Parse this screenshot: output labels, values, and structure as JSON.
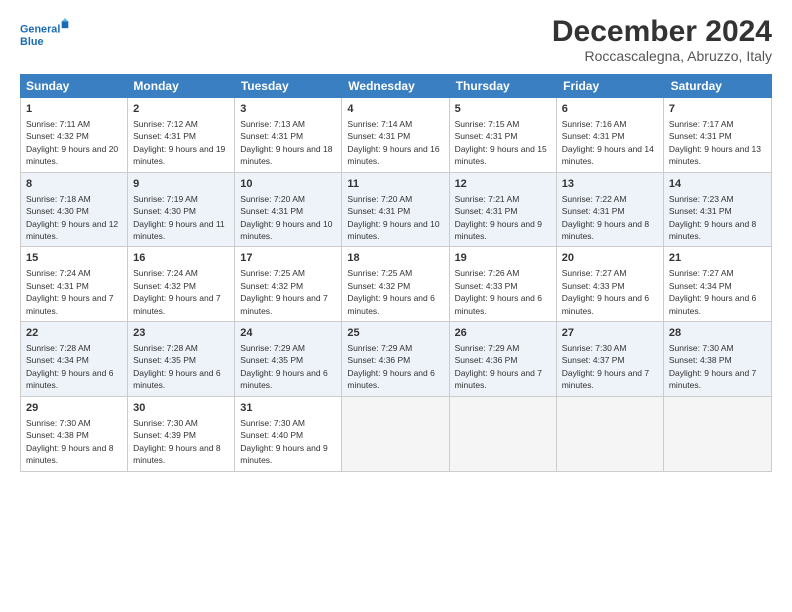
{
  "logo": {
    "line1": "General",
    "line2": "Blue"
  },
  "title": "December 2024",
  "location": "Roccascalegna, Abruzzo, Italy",
  "header_days": [
    "Sunday",
    "Monday",
    "Tuesday",
    "Wednesday",
    "Thursday",
    "Friday",
    "Saturday"
  ],
  "weeks": [
    [
      {
        "day": 1,
        "sunrise": "7:11 AM",
        "sunset": "4:32 PM",
        "daylight": "9 hours and 20 minutes."
      },
      {
        "day": 2,
        "sunrise": "7:12 AM",
        "sunset": "4:31 PM",
        "daylight": "9 hours and 19 minutes."
      },
      {
        "day": 3,
        "sunrise": "7:13 AM",
        "sunset": "4:31 PM",
        "daylight": "9 hours and 18 minutes."
      },
      {
        "day": 4,
        "sunrise": "7:14 AM",
        "sunset": "4:31 PM",
        "daylight": "9 hours and 16 minutes."
      },
      {
        "day": 5,
        "sunrise": "7:15 AM",
        "sunset": "4:31 PM",
        "daylight": "9 hours and 15 minutes."
      },
      {
        "day": 6,
        "sunrise": "7:16 AM",
        "sunset": "4:31 PM",
        "daylight": "9 hours and 14 minutes."
      },
      {
        "day": 7,
        "sunrise": "7:17 AM",
        "sunset": "4:31 PM",
        "daylight": "9 hours and 13 minutes."
      }
    ],
    [
      {
        "day": 8,
        "sunrise": "7:18 AM",
        "sunset": "4:30 PM",
        "daylight": "9 hours and 12 minutes."
      },
      {
        "day": 9,
        "sunrise": "7:19 AM",
        "sunset": "4:30 PM",
        "daylight": "9 hours and 11 minutes."
      },
      {
        "day": 10,
        "sunrise": "7:20 AM",
        "sunset": "4:31 PM",
        "daylight": "9 hours and 10 minutes."
      },
      {
        "day": 11,
        "sunrise": "7:20 AM",
        "sunset": "4:31 PM",
        "daylight": "9 hours and 10 minutes."
      },
      {
        "day": 12,
        "sunrise": "7:21 AM",
        "sunset": "4:31 PM",
        "daylight": "9 hours and 9 minutes."
      },
      {
        "day": 13,
        "sunrise": "7:22 AM",
        "sunset": "4:31 PM",
        "daylight": "9 hours and 8 minutes."
      },
      {
        "day": 14,
        "sunrise": "7:23 AM",
        "sunset": "4:31 PM",
        "daylight": "9 hours and 8 minutes."
      }
    ],
    [
      {
        "day": 15,
        "sunrise": "7:24 AM",
        "sunset": "4:31 PM",
        "daylight": "9 hours and 7 minutes."
      },
      {
        "day": 16,
        "sunrise": "7:24 AM",
        "sunset": "4:32 PM",
        "daylight": "9 hours and 7 minutes."
      },
      {
        "day": 17,
        "sunrise": "7:25 AM",
        "sunset": "4:32 PM",
        "daylight": "9 hours and 7 minutes."
      },
      {
        "day": 18,
        "sunrise": "7:25 AM",
        "sunset": "4:32 PM",
        "daylight": "9 hours and 6 minutes."
      },
      {
        "day": 19,
        "sunrise": "7:26 AM",
        "sunset": "4:33 PM",
        "daylight": "9 hours and 6 minutes."
      },
      {
        "day": 20,
        "sunrise": "7:27 AM",
        "sunset": "4:33 PM",
        "daylight": "9 hours and 6 minutes."
      },
      {
        "day": 21,
        "sunrise": "7:27 AM",
        "sunset": "4:34 PM",
        "daylight": "9 hours and 6 minutes."
      }
    ],
    [
      {
        "day": 22,
        "sunrise": "7:28 AM",
        "sunset": "4:34 PM",
        "daylight": "9 hours and 6 minutes."
      },
      {
        "day": 23,
        "sunrise": "7:28 AM",
        "sunset": "4:35 PM",
        "daylight": "9 hours and 6 minutes."
      },
      {
        "day": 24,
        "sunrise": "7:29 AM",
        "sunset": "4:35 PM",
        "daylight": "9 hours and 6 minutes."
      },
      {
        "day": 25,
        "sunrise": "7:29 AM",
        "sunset": "4:36 PM",
        "daylight": "9 hours and 6 minutes."
      },
      {
        "day": 26,
        "sunrise": "7:29 AM",
        "sunset": "4:36 PM",
        "daylight": "9 hours and 7 minutes."
      },
      {
        "day": 27,
        "sunrise": "7:30 AM",
        "sunset": "4:37 PM",
        "daylight": "9 hours and 7 minutes."
      },
      {
        "day": 28,
        "sunrise": "7:30 AM",
        "sunset": "4:38 PM",
        "daylight": "9 hours and 7 minutes."
      }
    ],
    [
      {
        "day": 29,
        "sunrise": "7:30 AM",
        "sunset": "4:38 PM",
        "daylight": "9 hours and 8 minutes."
      },
      {
        "day": 30,
        "sunrise": "7:30 AM",
        "sunset": "4:39 PM",
        "daylight": "9 hours and 8 minutes."
      },
      {
        "day": 31,
        "sunrise": "7:30 AM",
        "sunset": "4:40 PM",
        "daylight": "9 hours and 9 minutes."
      },
      null,
      null,
      null,
      null
    ]
  ],
  "labels": {
    "sunrise": "Sunrise:",
    "sunset": "Sunset:",
    "daylight": "Daylight:"
  }
}
